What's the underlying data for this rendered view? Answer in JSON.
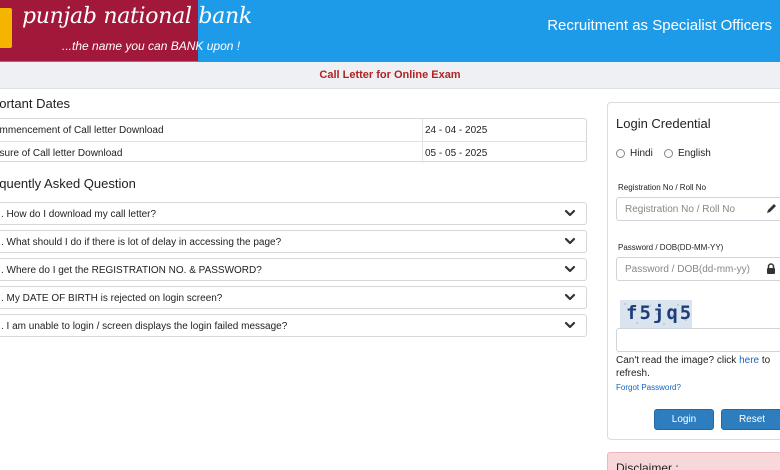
{
  "brand": {
    "name": "punjab national bank",
    "tagline": "...the name you can BANK upon !"
  },
  "header": {
    "title": "Recruitment as Specialist Officers"
  },
  "subheader": {
    "title": "Call Letter for Online Exam"
  },
  "important_dates": {
    "title": "portant Dates",
    "rows": [
      {
        "label": "ommencement of Call letter Download",
        "value": "24 - 04 - 2025"
      },
      {
        "label": "osure of Call letter Download",
        "value": "05 - 05 - 2025"
      }
    ]
  },
  "faq": {
    "title": "equently Asked Question",
    "items": [
      ". How do I download my call letter?",
      ". What should I do if there is lot of delay in accessing the page?",
      ". Where do I get the REGISTRATION NO. & PASSWORD?",
      ". My DATE OF BIRTH is rejected on login screen?",
      ". I am unable to login / screen displays the login failed message?"
    ]
  },
  "login": {
    "title": "Login Credential",
    "languages": [
      "Hindi",
      "English"
    ],
    "reg_label": "Registration No / Roll No",
    "reg_placeholder": "Registration No / Roll No",
    "pwd_label": "Password / DOB(DD-MM-YY)",
    "pwd_placeholder": "Password / DOB(dd-mm-yy)",
    "captcha_text": "f5jq5",
    "captcha_placeholder": "",
    "refresh_prefix": "Can't read the image? click ",
    "refresh_link": "here",
    "refresh_suffix": " to refresh.",
    "forgot": "Forgot Password?",
    "login_button": "Login",
    "reset_button": "Reset"
  },
  "disclaimer": {
    "title": "Disclaimer :"
  },
  "colors": {
    "header_blue": "#1e9be8",
    "logo_maroon": "#a2183a",
    "subheader_text": "#b22222",
    "button_blue": "#2e7ebf",
    "link_blue": "#1565c0",
    "disclaimer_bg": "#f8d7da"
  },
  "icons": {
    "faq_toggle": "chevron-down-icon",
    "registration_field": "pencil-icon",
    "password_field": "lock-icon"
  }
}
